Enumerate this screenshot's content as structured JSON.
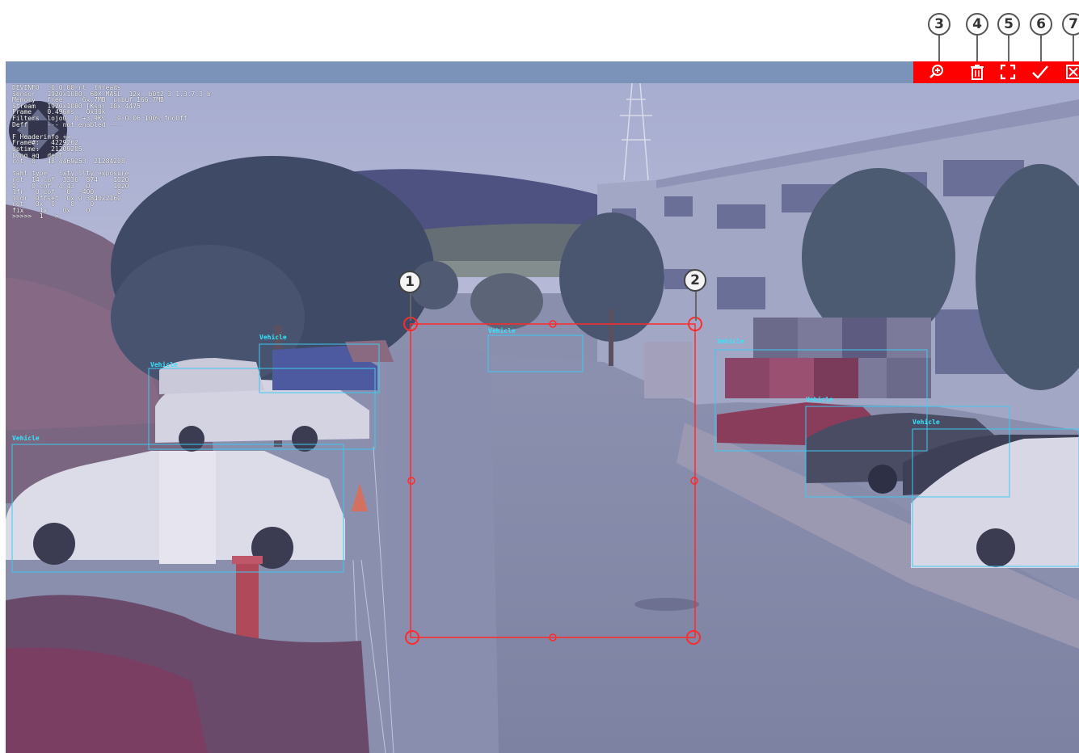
{
  "callouts": {
    "c1": "1",
    "c2": "2",
    "c3": "3",
    "c4": "4",
    "c5": "5",
    "c6": "6",
    "c7": "7"
  },
  "toolbar": {
    "zoom": "zoom-in-icon",
    "delete": "trash-icon",
    "fullscreen": "fullscreen-icon",
    "confirm": "checkmark-icon",
    "close": "close-box-icon"
  },
  "colors": {
    "toolbar_bg": "#ff0000",
    "header_bar": "#7b93b8",
    "region": "#ff2a2a",
    "detection": "#3fc8f0"
  },
  "osd": {
    "lines": [
      "DEVINFO  :0,0,00-rt  threads",
      "Sensor   1920x1080, 60X MASL  12x  b0t2 3 1.3.7.3 b",
      "Memory   free   . 6x.7MB  unbuf 166.7MB",
      "Stream   1920x1080 [Ksnr 10x 4475",
      "Frame    0.496ms   0x30k",
      "Filters  lojo0 .0 +3.9K%  .0 0.06 100%.fnoOff",
      "Deff     --- not enabled ---",
      "",
      "F Headerinfo +>",
      "Frame#:   4229262",
      "Uptime:   21209205",
      "Lonq_aq  delt",
      "rot  0   48 4469253  21284208",
      "",
      "tamt type   lxty llty exposure",
      "rot  14 cof  3336  874    1020",
      "0    0 cof  4.43   0      1020",
      "lfr   0 cof   0  -400      0",
      "lhdr  0ffset  0x 0 3840x2160",
      "rot   0x  0    0    0",
      "fix    1x    0x    0",
      ">>>>>  1   >"
    ]
  },
  "detections": {
    "label": "Vehicle"
  }
}
